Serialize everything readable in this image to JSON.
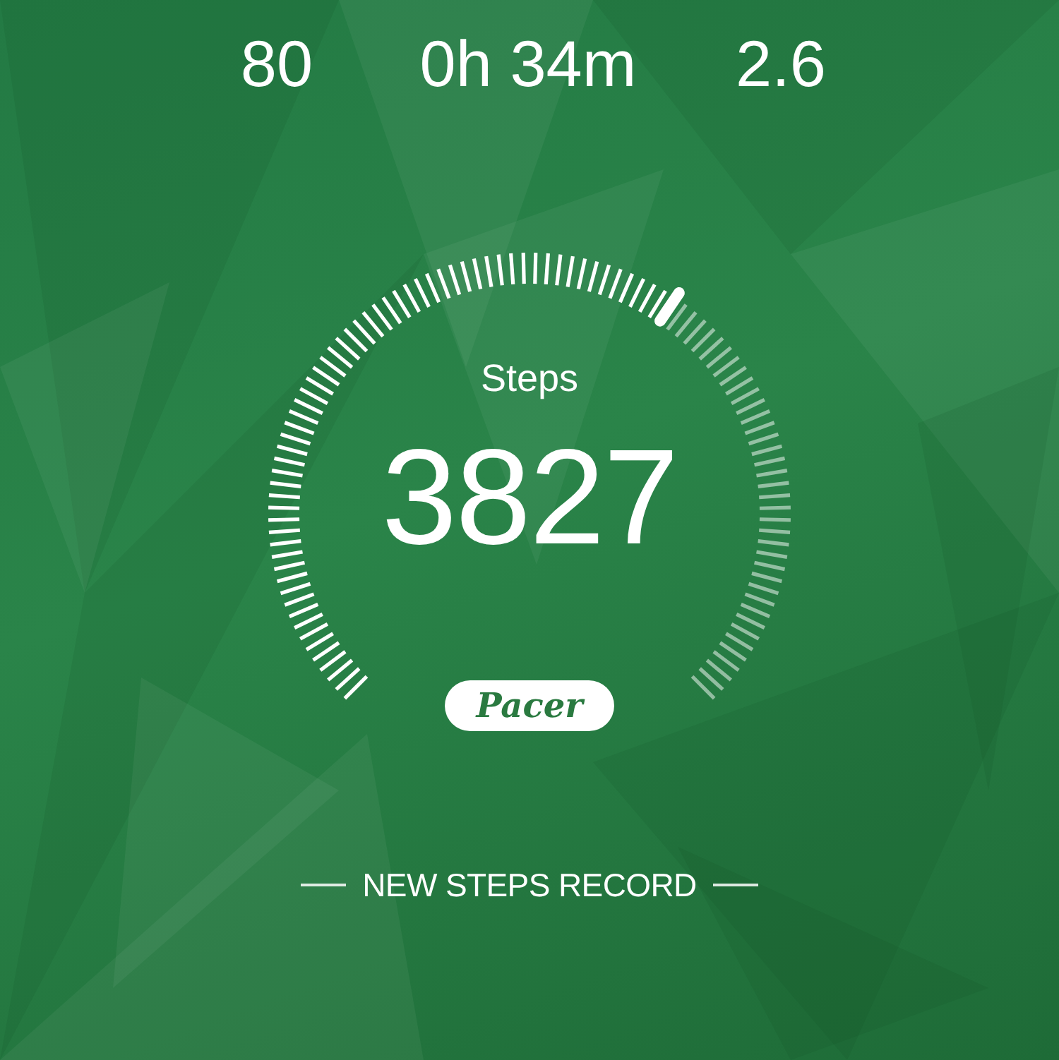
{
  "stats": [
    {
      "value": "80"
    },
    {
      "value": "0h 34m"
    },
    {
      "value": "2.6"
    }
  ],
  "gauge": {
    "label": "Steps",
    "value": "3827"
  },
  "logo": "Pacer",
  "record_banner": "NEW STEPS RECORD"
}
